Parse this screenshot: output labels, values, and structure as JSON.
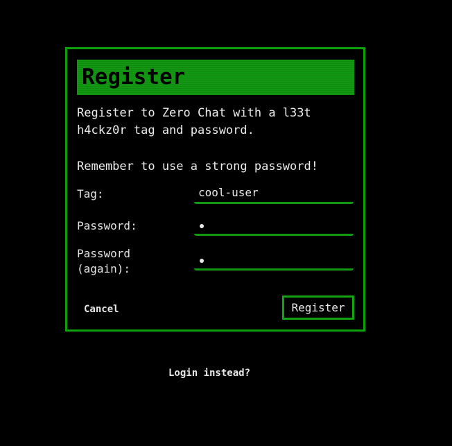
{
  "dialog": {
    "title": "Register",
    "description": "Register to Zero Chat with a l33t\nh4ckz0r tag and password.",
    "reminder": "Remember to use a strong password!",
    "fields": {
      "tag": {
        "label": "Tag:",
        "value": "cool-user"
      },
      "password": {
        "label": "Password:",
        "value": "•"
      },
      "password_again": {
        "label": "Password\n(again):",
        "value": "•"
      }
    },
    "cancel_label": "Cancel",
    "register_label": "Register"
  },
  "login_link": "Login instead?",
  "colors": {
    "accent": "#139813",
    "border": "#0aa10a",
    "background": "#000000",
    "text": "#e8e8e8"
  }
}
